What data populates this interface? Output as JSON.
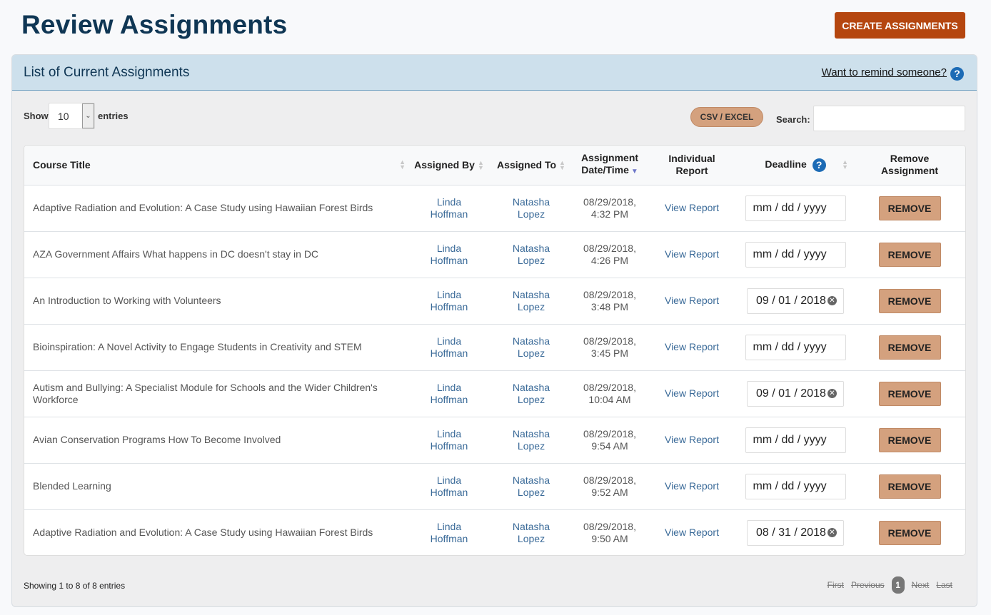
{
  "header": {
    "title": "Review Assignments",
    "create_label": "CREATE ASSIGNMENTS"
  },
  "panel": {
    "title": "List of Current Assignments",
    "remind_link": "Want to remind someone?",
    "help_glyph": "?"
  },
  "controls": {
    "show_label": "Show",
    "entries_value": "10",
    "entries_label": "entries",
    "csv_label": "CSV / EXCEL",
    "search_label": "Search:",
    "search_value": ""
  },
  "table": {
    "headers": {
      "course": "Course Title",
      "assigned_by": "Assigned By",
      "assigned_to": "Assigned To",
      "date_l1": "Assignment",
      "date_l2": "Date/Time",
      "report_l1": "Individual",
      "report_l2": "Report",
      "deadline": "Deadline",
      "remove_l1": "Remove",
      "remove_l2": "Assignment"
    },
    "rows": [
      {
        "course": "Adaptive Radiation and Evolution: A Case Study using Hawaiian Forest Birds",
        "by_first": "Linda",
        "by_last": "Hoffman",
        "to_first": "Natasha",
        "to_last": "Lopez",
        "date": "08/29/2018,",
        "time": "4:32 PM",
        "report": "View Report",
        "deadline": "mm / dd / yyyy",
        "deadline_set": false,
        "remove": "REMOVE"
      },
      {
        "course": "AZA Government Affairs What happens in DC doesn't stay in DC",
        "by_first": "Linda",
        "by_last": "Hoffman",
        "to_first": "Natasha",
        "to_last": "Lopez",
        "date": "08/29/2018,",
        "time": "4:26 PM",
        "report": "View Report",
        "deadline": "mm / dd / yyyy",
        "deadline_set": false,
        "remove": "REMOVE"
      },
      {
        "course": "An Introduction to Working with Volunteers",
        "by_first": "Linda",
        "by_last": "Hoffman",
        "to_first": "Natasha",
        "to_last": "Lopez",
        "date": "08/29/2018,",
        "time": "3:48 PM",
        "report": "View Report",
        "deadline": "09 / 01 / 2018",
        "deadline_set": true,
        "remove": "REMOVE"
      },
      {
        "course": "Bioinspiration: A Novel Activity to Engage Students in Creativity and STEM",
        "by_first": "Linda",
        "by_last": "Hoffman",
        "to_first": "Natasha",
        "to_last": "Lopez",
        "date": "08/29/2018,",
        "time": "3:45 PM",
        "report": "View Report",
        "deadline": "mm / dd / yyyy",
        "deadline_set": false,
        "remove": "REMOVE"
      },
      {
        "course": "Autism and Bullying: A Specialist Module for Schools and the Wider Children's Workforce",
        "by_first": "Linda",
        "by_last": "Hoffman",
        "to_first": "Natasha",
        "to_last": "Lopez",
        "date": "08/29/2018,",
        "time": "10:04 AM",
        "report": "View Report",
        "deadline": "09 / 01 / 2018",
        "deadline_set": true,
        "remove": "REMOVE"
      },
      {
        "course": "Avian Conservation Programs How To Become Involved",
        "by_first": "Linda",
        "by_last": "Hoffman",
        "to_first": "Natasha",
        "to_last": "Lopez",
        "date": "08/29/2018,",
        "time": "9:54 AM",
        "report": "View Report",
        "deadline": "mm / dd / yyyy",
        "deadline_set": false,
        "remove": "REMOVE"
      },
      {
        "course": "Blended Learning",
        "by_first": "Linda",
        "by_last": "Hoffman",
        "to_first": "Natasha",
        "to_last": "Lopez",
        "date": "08/29/2018,",
        "time": "9:52 AM",
        "report": "View Report",
        "deadline": "mm / dd / yyyy",
        "deadline_set": false,
        "remove": "REMOVE"
      },
      {
        "course": "Adaptive Radiation and Evolution: A Case Study using Hawaiian Forest Birds",
        "by_first": "Linda",
        "by_last": "Hoffman",
        "to_first": "Natasha",
        "to_last": "Lopez",
        "date": "08/29/2018,",
        "time": "9:50 AM",
        "report": "View Report",
        "deadline": "08 / 31 / 2018",
        "deadline_set": true,
        "remove": "REMOVE"
      }
    ]
  },
  "footer": {
    "showing": "Showing 1 to 8 of 8 entries",
    "first": "First",
    "previous": "Previous",
    "current_page": "1",
    "next": "Next",
    "last": "Last"
  },
  "icons": {
    "help": "question-circle-icon",
    "clear": "clear-x-icon",
    "sort": "sort-both-icon",
    "sort_active": "sort-desc-icon",
    "dropdown": "chevron-down-icon"
  },
  "colors": {
    "title": "#0f3654",
    "primary_button": "#b5460f",
    "accent_button": "#d4a17e",
    "panel_header": "#cde0ec",
    "link": "#3a6a98",
    "help": "#1c6bb5"
  }
}
